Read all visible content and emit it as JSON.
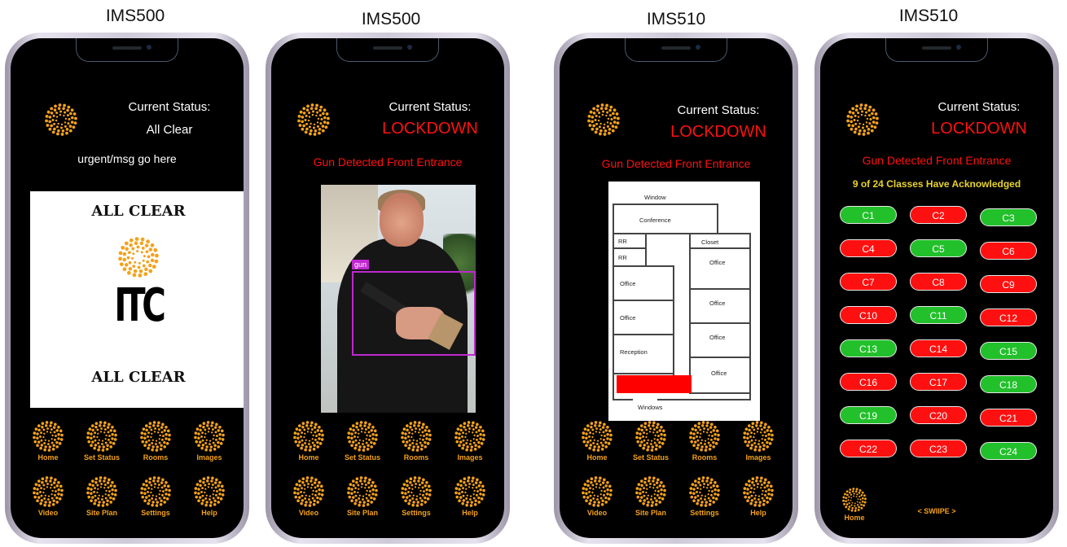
{
  "phones": [
    {
      "model": "IMS500",
      "status_label": "Current Status:",
      "status_value": "All Clear",
      "message": "urgent/msg go here",
      "panel": {
        "top_text": "ALL CLEAR",
        "logo_text": "ITC",
        "bottom_text": "ALL CLEAR"
      }
    },
    {
      "model": "IMS500",
      "status_label": "Current Status:",
      "status_value": "LOCKDOWN",
      "message": "Gun Detected Front Entrance",
      "detection_label": "gun"
    },
    {
      "model": "IMS510",
      "status_label": "Current Status:",
      "status_value": "LOCKDOWN",
      "message": "Gun Detected Front Entrance",
      "floor_plan": {
        "rooms": [
          "Window",
          "Conference",
          "RR",
          "Closet",
          "RR",
          "Office",
          "Office",
          "Office",
          "Office",
          "Office",
          "Reception",
          "Office",
          "Windows"
        ]
      }
    },
    {
      "model": "IMS510",
      "status_label": "Current Status:",
      "status_value": "LOCKDOWN",
      "message": "Gun Detected Front Entrance",
      "acknowledged": "9 of 24 Classes Have Acknowledged",
      "classes": [
        {
          "label": "C1",
          "state": "green"
        },
        {
          "label": "C2",
          "state": "red"
        },
        {
          "label": "C3",
          "state": "green"
        },
        {
          "label": "C4",
          "state": "red"
        },
        {
          "label": "C5",
          "state": "green"
        },
        {
          "label": "C6",
          "state": "red"
        },
        {
          "label": "C7",
          "state": "red"
        },
        {
          "label": "C8",
          "state": "red"
        },
        {
          "label": "C9",
          "state": "red"
        },
        {
          "label": "C10",
          "state": "red"
        },
        {
          "label": "C11",
          "state": "green"
        },
        {
          "label": "C12",
          "state": "red"
        },
        {
          "label": "C13",
          "state": "green"
        },
        {
          "label": "C14",
          "state": "red"
        },
        {
          "label": "C15",
          "state": "green"
        },
        {
          "label": "C16",
          "state": "red"
        },
        {
          "label": "C17",
          "state": "red"
        },
        {
          "label": "C18",
          "state": "green"
        },
        {
          "label": "C19",
          "state": "green"
        },
        {
          "label": "C20",
          "state": "red"
        },
        {
          "label": "C21",
          "state": "red"
        },
        {
          "label": "C22",
          "state": "red"
        },
        {
          "label": "C23",
          "state": "red"
        },
        {
          "label": "C24",
          "state": "green"
        }
      ],
      "home_label": "Home",
      "swipe_text": "< SWIIPE >"
    }
  ],
  "nav": [
    "Home",
    "Set Status",
    "Rooms",
    "Images",
    "Video",
    "Site Plan",
    "Settings",
    "Help"
  ],
  "colors": {
    "accent": "#f5a21a",
    "alert": "#ff1010",
    "ack": "#e8d22a",
    "ok": "#22c02a"
  },
  "icons": {
    "logo": "sunburst-logo-icon",
    "nav": "sunburst-icon"
  }
}
